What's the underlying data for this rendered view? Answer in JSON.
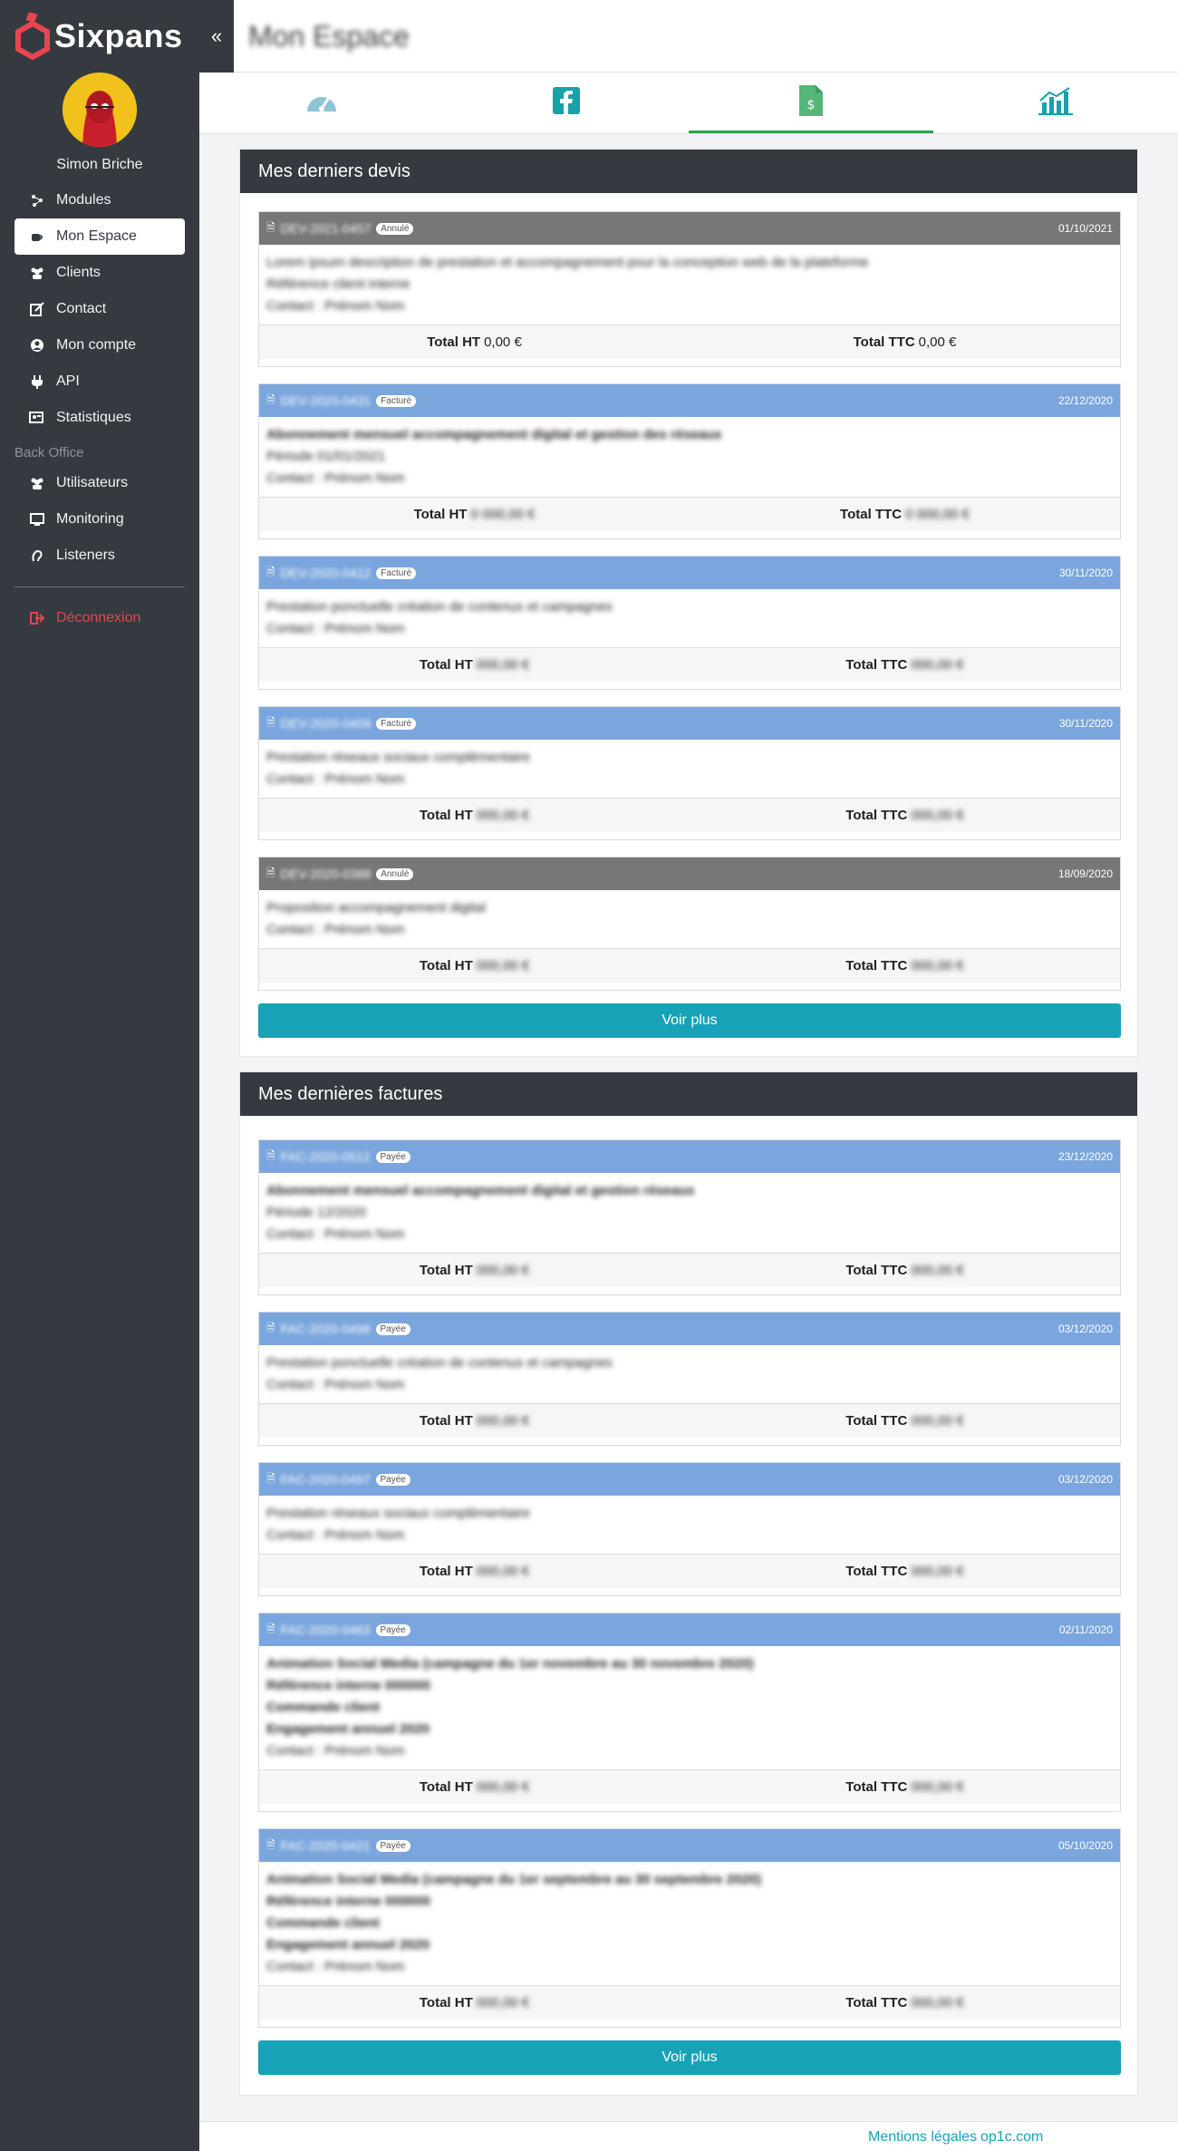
{
  "app": {
    "brand": "Sixpans",
    "user": "Simon Briche",
    "page_title": "Mon Espace"
  },
  "sidebar": {
    "items": [
      {
        "label": "Modules",
        "icon": "modules-icon"
      },
      {
        "label": "Mon Espace",
        "icon": "coffee-icon"
      },
      {
        "label": "Clients",
        "icon": "users-icon"
      },
      {
        "label": "Contact",
        "icon": "contact-icon"
      },
      {
        "label": "Mon compte",
        "icon": "account-icon"
      },
      {
        "label": "API",
        "icon": "plug-icon"
      },
      {
        "label": "Statistiques",
        "icon": "stats-icon"
      }
    ],
    "section": "Back Office",
    "bo_items": [
      {
        "label": "Utilisateurs",
        "icon": "users-icon"
      },
      {
        "label": "Monitoring",
        "icon": "monitor-icon"
      },
      {
        "label": "Listeners",
        "icon": "listener-icon"
      }
    ],
    "logout": "Déconnexion"
  },
  "devis": {
    "title": "Mes derniers devis",
    "more": "Voir plus",
    "items": [
      {
        "status": "Annulé",
        "date": "01/10/2021",
        "total_ht_label": "Total HT",
        "total_ht": "0,00 €",
        "total_ttc_label": "Total TTC",
        "total_ttc": "0,00 €"
      },
      {
        "status": "Facturé",
        "date": "22/12/2020",
        "total_ht_label": "Total HT",
        "total_ttc_label": "Total TTC"
      },
      {
        "status": "Facturé",
        "date": "30/11/2020",
        "total_ht_label": "Total HT",
        "total_ttc_label": "Total TTC"
      },
      {
        "status": "Facturé",
        "date": "30/11/2020",
        "total_ht_label": "Total HT",
        "total_ttc_label": "Total TTC"
      },
      {
        "status": "Annulé",
        "date": "18/09/2020",
        "total_ht_label": "Total HT",
        "total_ttc_label": "Total TTC"
      }
    ]
  },
  "factures": {
    "title": "Mes dernières factures",
    "more": "Voir plus",
    "items": [
      {
        "status": "Payée",
        "date": "23/12/2020",
        "total_ht_label": "Total HT",
        "total_ttc_label": "Total TTC"
      },
      {
        "status": "Payée",
        "date": "03/12/2020",
        "total_ht_label": "Total HT",
        "total_ttc_label": "Total TTC"
      },
      {
        "status": "Payée",
        "date": "03/12/2020",
        "total_ht_label": "Total HT",
        "total_ttc_label": "Total TTC"
      },
      {
        "status": "Payée",
        "date": "02/11/2020",
        "total_ht_label": "Total HT",
        "total_ttc_label": "Total TTC"
      },
      {
        "status": "Payée",
        "date": "05/10/2020",
        "total_ht_label": "Total HT",
        "total_ttc_label": "Total TTC"
      }
    ]
  },
  "footer": {
    "legal": "Mentions légales",
    "site": "op1c.com"
  },
  "colors": {
    "accent": "#17a2b8",
    "sidebar": "#343a40",
    "invoiced": "#7aa6dd",
    "cancelled": "#777777",
    "logout": "#e0454f"
  }
}
